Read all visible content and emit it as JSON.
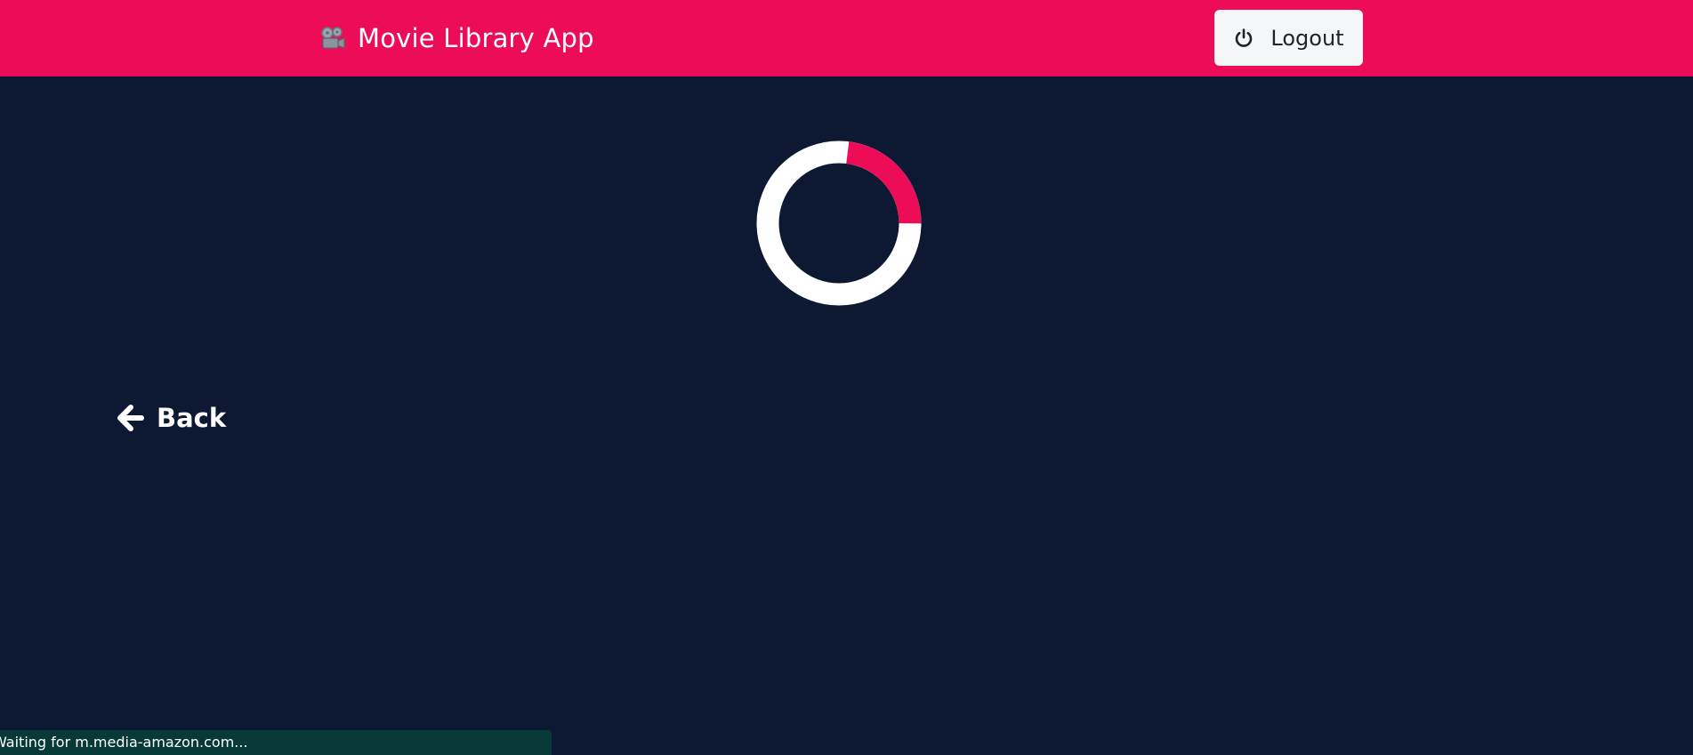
{
  "header": {
    "app_title": "Movie Library App",
    "brand_icon": "film-projector-icon",
    "logout_label": "Logout",
    "logout_icon": "power-icon",
    "background_color": "#ec0c57"
  },
  "main": {
    "background_color": "#0d1832",
    "spinner": {
      "icon": "loading-spinner",
      "track_color": "#ffffff",
      "accent_color": "#ec0c57"
    },
    "back_label": "Back",
    "back_icon": "arrow-left-icon"
  },
  "status_bar": {
    "text": "Waiting for m.media-amazon.com..."
  }
}
